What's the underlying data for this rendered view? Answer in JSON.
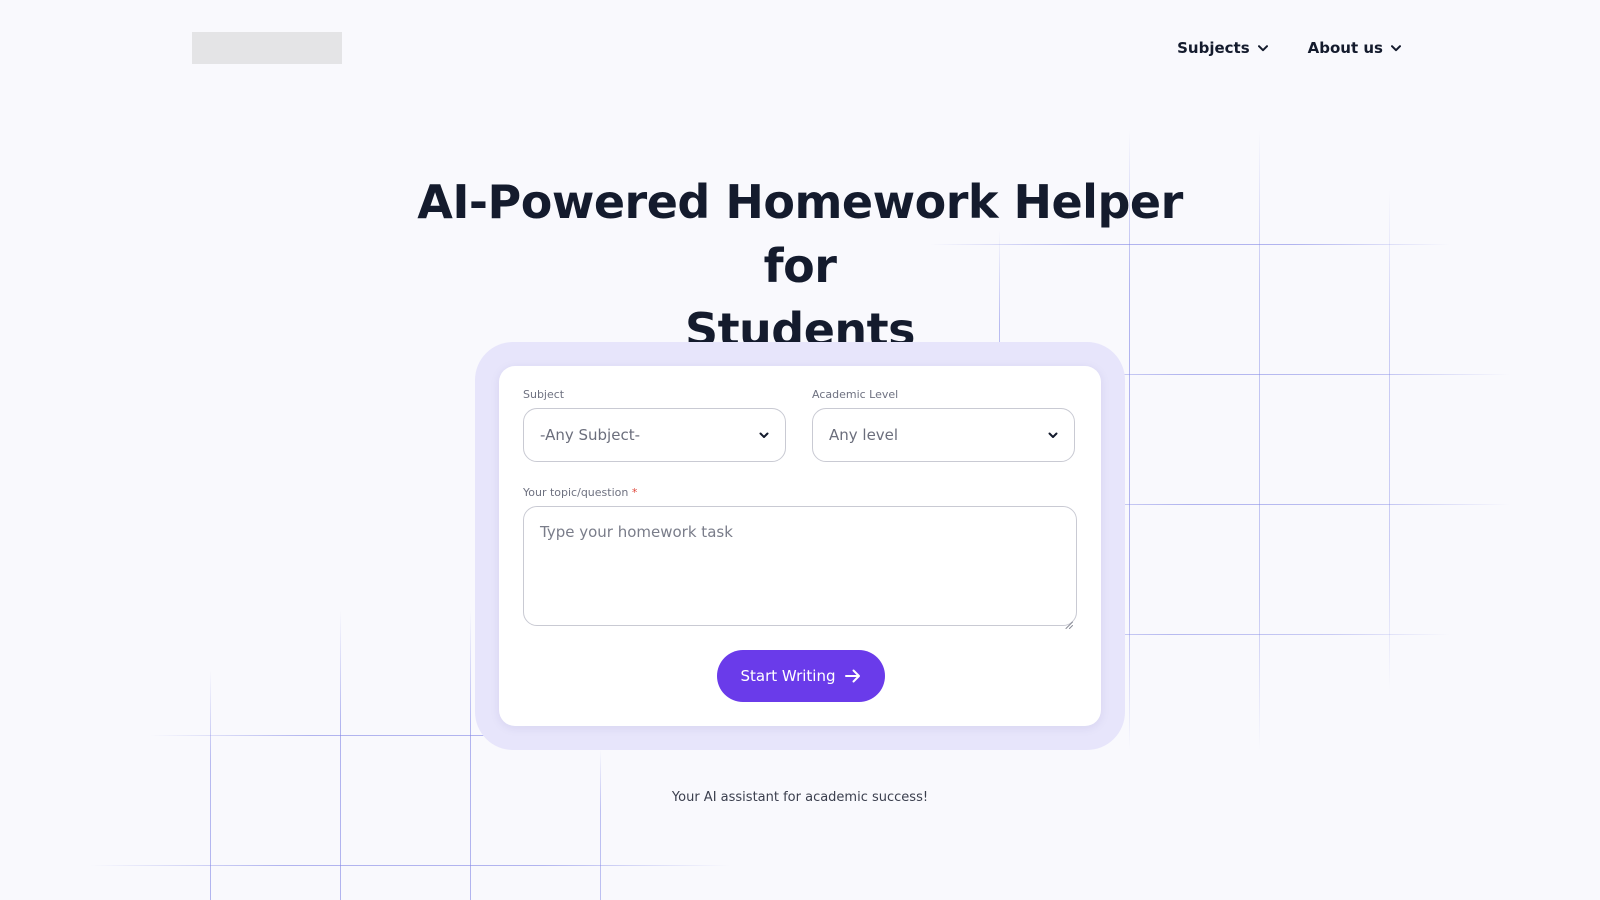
{
  "header": {
    "logo_alt": "",
    "nav": [
      {
        "label": "Subjects",
        "icon": "chevron-down-icon"
      },
      {
        "label": "About us",
        "icon": "chevron-down-icon"
      }
    ]
  },
  "hero": {
    "title_line1": "AI-Powered Homework Helper for",
    "title_line2": "Students"
  },
  "form": {
    "subject": {
      "label": "Subject",
      "value": "-Any Subject-"
    },
    "level": {
      "label": "Academic Level",
      "value": "Any level"
    },
    "topic": {
      "label": "Your topic/question",
      "required_mark": "*",
      "placeholder": "Type your homework task"
    },
    "submit_label": "Start Writing"
  },
  "tagline": "Your AI assistant for academic success!",
  "colors": {
    "accent": "#6a3bea",
    "card_frame": "#e7e5fb",
    "grid_line": "#c7c9f2",
    "background": "#f9f9fd"
  }
}
